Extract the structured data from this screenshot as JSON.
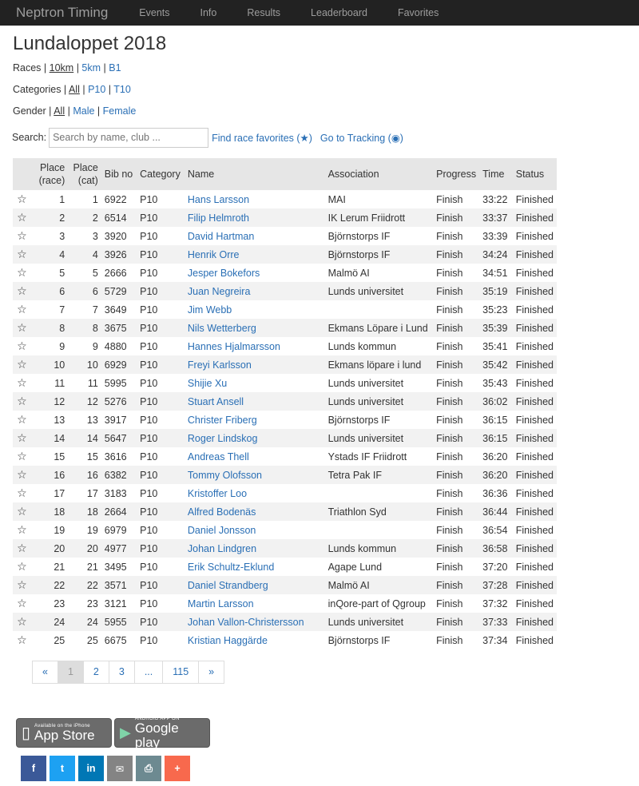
{
  "nav": {
    "brand": "Neptron Timing",
    "items": [
      "Events",
      "Info",
      "Results",
      "Leaderboard",
      "Favorites"
    ]
  },
  "page_title": "Lundaloppet 2018",
  "races": {
    "label": "Races",
    "options": [
      "10km",
      "5km",
      "B1"
    ],
    "active": "10km"
  },
  "categories": {
    "label": "Categories",
    "options": [
      "All",
      "P10",
      "T10"
    ],
    "active": "All"
  },
  "gender": {
    "label": "Gender",
    "options": [
      "All",
      "Male",
      "Female"
    ],
    "active": "All"
  },
  "search": {
    "label": "Search:",
    "placeholder": "Search by name, club ...",
    "favorites_link": "Find race favorites (★)",
    "tracking_link": "Go to Tracking (◉)"
  },
  "table": {
    "headers": [
      "Place (race)",
      "Place (cat)",
      "Bib no",
      "Category",
      "Name",
      "Association",
      "Progress",
      "Time",
      "Status"
    ],
    "star_icon": "☆",
    "rows": [
      [
        "1",
        "1",
        "6922",
        "P10",
        "Hans Larsson",
        "MAI",
        "Finish",
        "33:22",
        "Finished"
      ],
      [
        "2",
        "2",
        "6514",
        "P10",
        "Filip Helmroth",
        "IK Lerum Friidrott",
        "Finish",
        "33:37",
        "Finished"
      ],
      [
        "3",
        "3",
        "3920",
        "P10",
        "David Hartman",
        "Björnstorps IF",
        "Finish",
        "33:39",
        "Finished"
      ],
      [
        "4",
        "4",
        "3926",
        "P10",
        "Henrik Orre",
        "Björnstorps IF",
        "Finish",
        "34:24",
        "Finished"
      ],
      [
        "5",
        "5",
        "2666",
        "P10",
        "Jesper Bokefors",
        "Malmö AI",
        "Finish",
        "34:51",
        "Finished"
      ],
      [
        "6",
        "6",
        "5729",
        "P10",
        "Juan Negreira",
        "Lunds universitet",
        "Finish",
        "35:19",
        "Finished"
      ],
      [
        "7",
        "7",
        "3649",
        "P10",
        "Jim Webb",
        "",
        "Finish",
        "35:23",
        "Finished"
      ],
      [
        "8",
        "8",
        "3675",
        "P10",
        "Nils Wetterberg",
        "Ekmans Löpare i Lund",
        "Finish",
        "35:39",
        "Finished"
      ],
      [
        "9",
        "9",
        "4880",
        "P10",
        "Hannes Hjalmarsson",
        "Lunds kommun",
        "Finish",
        "35:41",
        "Finished"
      ],
      [
        "10",
        "10",
        "6929",
        "P10",
        "Freyi Karlsson",
        "Ekmans löpare i lund",
        "Finish",
        "35:42",
        "Finished"
      ],
      [
        "11",
        "11",
        "5995",
        "P10",
        "Shijie Xu",
        "Lunds universitet",
        "Finish",
        "35:43",
        "Finished"
      ],
      [
        "12",
        "12",
        "5276",
        "P10",
        "Stuart Ansell",
        "Lunds universitet",
        "Finish",
        "36:02",
        "Finished"
      ],
      [
        "13",
        "13",
        "3917",
        "P10",
        "Christer Friberg",
        "Björnstorps IF",
        "Finish",
        "36:15",
        "Finished"
      ],
      [
        "14",
        "14",
        "5647",
        "P10",
        "Roger Lindskog",
        "Lunds universitet",
        "Finish",
        "36:15",
        "Finished"
      ],
      [
        "15",
        "15",
        "3616",
        "P10",
        "Andreas Thell",
        "Ystads IF Friidrott",
        "Finish",
        "36:20",
        "Finished"
      ],
      [
        "16",
        "16",
        "6382",
        "P10",
        "Tommy Olofsson",
        "Tetra Pak IF",
        "Finish",
        "36:20",
        "Finished"
      ],
      [
        "17",
        "17",
        "3183",
        "P10",
        "Kristoffer Loo",
        "",
        "Finish",
        "36:36",
        "Finished"
      ],
      [
        "18",
        "18",
        "2664",
        "P10",
        "Alfred Bodenäs",
        "Triathlon Syd",
        "Finish",
        "36:44",
        "Finished"
      ],
      [
        "19",
        "19",
        "6979",
        "P10",
        "Daniel Jonsson",
        "",
        "Finish",
        "36:54",
        "Finished"
      ],
      [
        "20",
        "20",
        "4977",
        "P10",
        "Johan Lindgren",
        "Lunds kommun",
        "Finish",
        "36:58",
        "Finished"
      ],
      [
        "21",
        "21",
        "3495",
        "P10",
        "Erik Schultz-Eklund",
        "Agape Lund",
        "Finish",
        "37:20",
        "Finished"
      ],
      [
        "22",
        "22",
        "3571",
        "P10",
        "Daniel Strandberg",
        "Malmö AI",
        "Finish",
        "37:28",
        "Finished"
      ],
      [
        "23",
        "23",
        "3121",
        "P10",
        "Martin Larsson",
        "inQore-part of Qgroup",
        "Finish",
        "37:32",
        "Finished"
      ],
      [
        "24",
        "24",
        "5955",
        "P10",
        "Johan Vallon-Christersson",
        "Lunds universitet",
        "Finish",
        "37:33",
        "Finished"
      ],
      [
        "25",
        "25",
        "6675",
        "P10",
        "Kristian Haggärde",
        "Björnstorps IF",
        "Finish",
        "37:34",
        "Finished"
      ]
    ]
  },
  "pagination": [
    "«",
    "1",
    "2",
    "3",
    "...",
    "115",
    "»"
  ],
  "pagination_active": "1",
  "stores": {
    "apple_small": "Available on the iPhone",
    "apple_big": "App Store",
    "google_small": "ANDROID APP ON",
    "google_big": "Google play"
  },
  "social": [
    {
      "name": "facebook",
      "glyph": "f",
      "color": "#3b5998"
    },
    {
      "name": "twitter",
      "glyph": "t",
      "color": "#1da1f2"
    },
    {
      "name": "linkedin",
      "glyph": "in",
      "color": "#0077b5"
    },
    {
      "name": "email",
      "glyph": "✉",
      "color": "#848484"
    },
    {
      "name": "print",
      "glyph": "⎙",
      "color": "#6d8a91"
    },
    {
      "name": "more",
      "glyph": "+",
      "color": "#f8694d"
    }
  ]
}
